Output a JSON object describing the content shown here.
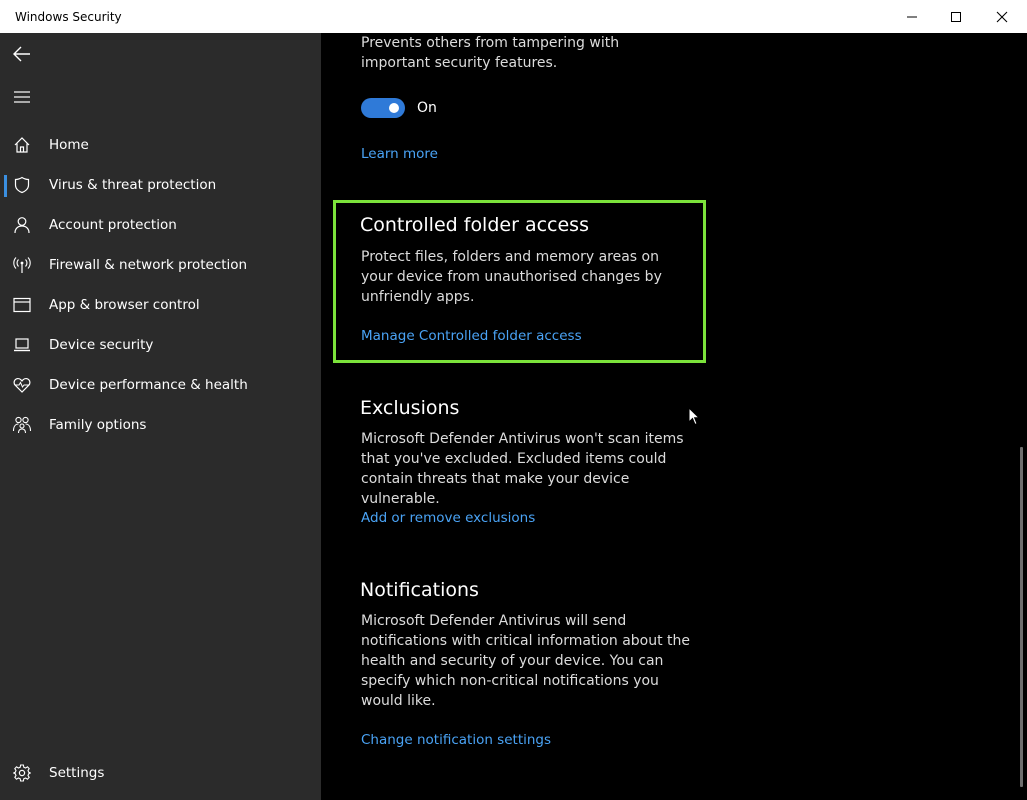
{
  "window": {
    "title": "Windows Security"
  },
  "sidebar": {
    "items": [
      {
        "label": "Home",
        "icon": "home-icon"
      },
      {
        "label": "Virus & threat protection",
        "icon": "shield-icon",
        "active": true
      },
      {
        "label": "Account protection",
        "icon": "person-icon"
      },
      {
        "label": "Firewall & network protection",
        "icon": "wireless-icon"
      },
      {
        "label": "App & browser control",
        "icon": "browser-window-icon"
      },
      {
        "label": "Device security",
        "icon": "laptop-icon"
      },
      {
        "label": "Device performance & health",
        "icon": "heart-pulse-icon"
      },
      {
        "label": "Family options",
        "icon": "family-icon"
      }
    ],
    "settings_label": "Settings"
  },
  "main": {
    "tamper": {
      "description": "Prevents others from tampering with important security features.",
      "toggle_state": "On",
      "learn_more": "Learn more"
    },
    "controlled_folder": {
      "title": "Controlled folder access",
      "description": "Protect files, folders and memory areas on your device from unauthorised changes by unfriendly apps.",
      "link": "Manage Controlled folder access"
    },
    "exclusions": {
      "title": "Exclusions",
      "description": "Microsoft Defender Antivirus won't scan items that you've excluded. Excluded items could contain threats that make your device vulnerable.",
      "link": "Add or remove exclusions"
    },
    "notifications": {
      "title": "Notifications",
      "description": "Microsoft Defender Antivirus will send notifications with critical information about the health and security of your device. You can specify which non-critical notifications you would like.",
      "link": "Change notification settings"
    }
  },
  "colors": {
    "accent": "#2f7ad8",
    "link": "#4aa3f5",
    "highlight": "#7ce33b",
    "sidebar_bg": "#2b2b2b"
  }
}
